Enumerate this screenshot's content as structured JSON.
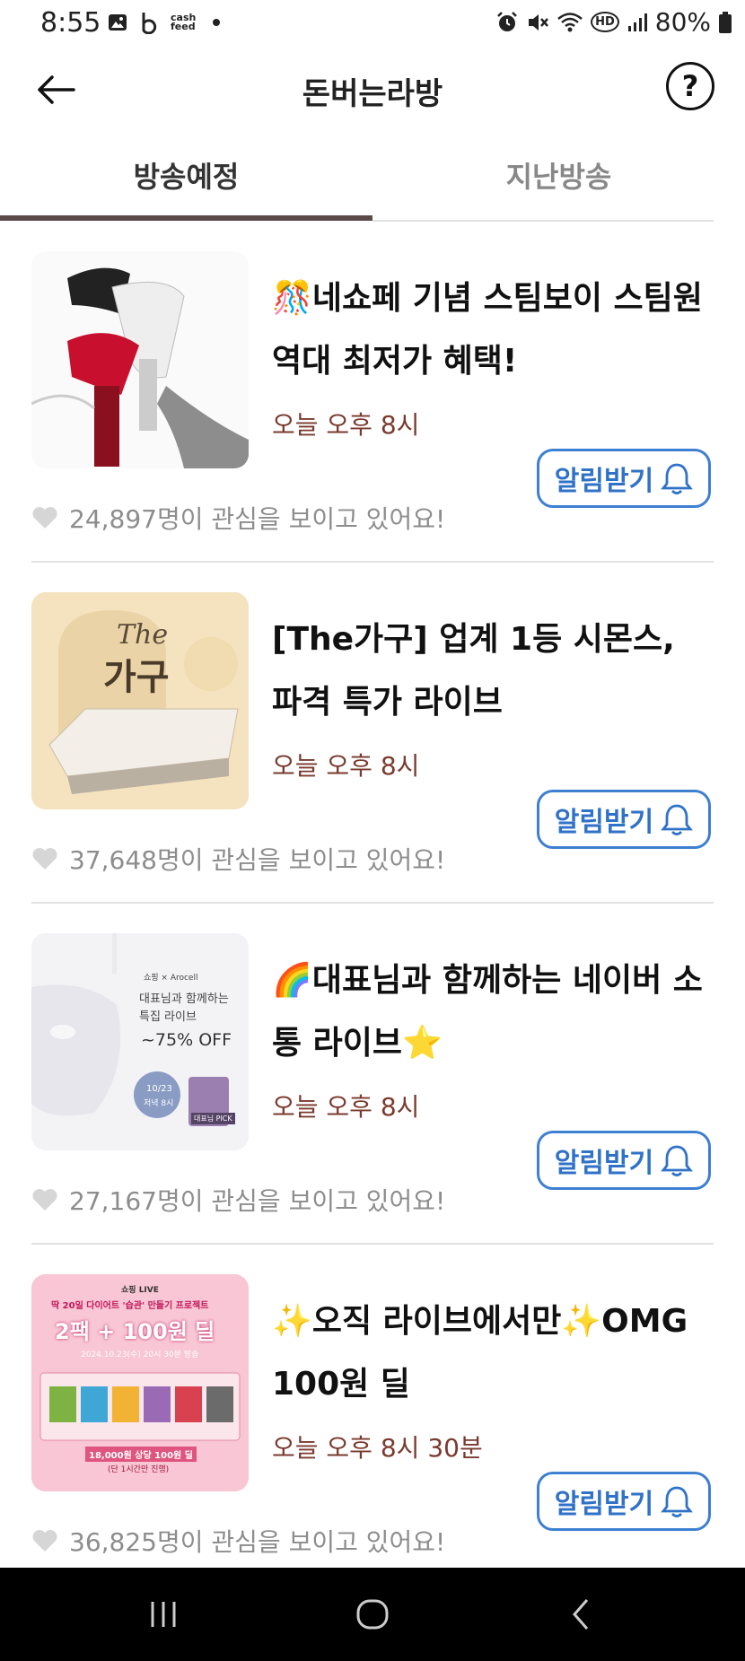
{
  "status_bar": {
    "time": "8:55",
    "cash_line1": "cash",
    "cash_line2": "feed",
    "battery": "80%",
    "hd": "HD"
  },
  "header": {
    "title": "돈버는라방",
    "help_label": "?"
  },
  "tabs": [
    {
      "label": "방송예정",
      "active": true
    },
    {
      "label": "지난방송",
      "active": false
    }
  ],
  "alarm_label": "알림받기",
  "items": [
    {
      "title": "🎊네쇼페 기념 스팀보이 스팀원 역대 최저가 혜택!",
      "time": "오늘 오후 8시",
      "interest": "24,897명이 관심을 보이고 있어요!"
    },
    {
      "title": "[The가구] 업계 1등 시몬스, 파격 특가 라이브",
      "time": "오늘 오후 8시",
      "interest": "37,648명이 관심을 보이고 있어요!"
    },
    {
      "title": "🌈대표님과 함께하는 네이버 소통 라이브⭐",
      "time": "오늘 오후 8시",
      "interest": "27,167명이 관심을 보이고 있어요!"
    },
    {
      "title": "✨오직 라이브에서만✨OMG 100원 딜",
      "time": "오늘 오후 8시 30분",
      "interest": "36,825명이 관심을 보이고 있어요!"
    }
  ],
  "thumb_texts": {
    "furniture_the": "The",
    "furniture_ga": "가구",
    "mask_brand": "쇼핑 × Arocell",
    "mask_line1": "대표님과 함께하는",
    "mask_line2": "특집 라이브",
    "mask_off": "~75% OFF",
    "mask_date": "10/23",
    "mask_date2": "저녁 8시",
    "mask_pick": "대표님 PICK",
    "omg_brand": "쇼핑 LIVE",
    "omg_line1": "딱 20일 다이어트 '습관' 만들기 프로젝트",
    "omg_main": "2팩 + 100원 딜",
    "omg_date": "2024.10.23(수) 20시 30분 방송",
    "omg_price": "18,000원 상당 100원 딜",
    "omg_note": "(단 1시간만 진행)"
  }
}
